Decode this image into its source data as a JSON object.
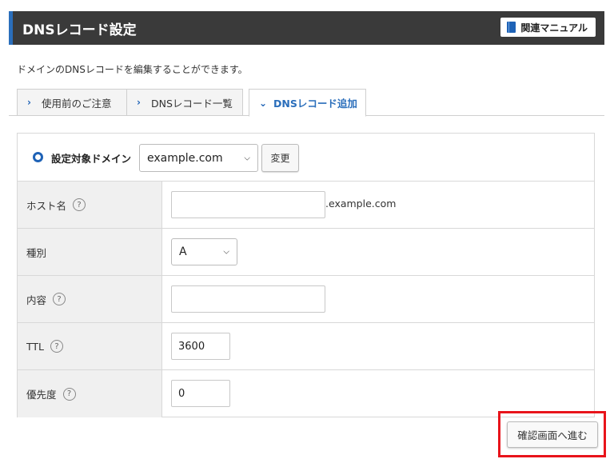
{
  "header": {
    "title": "DNSレコード設定",
    "manual_label": "関連マニュアル"
  },
  "description": "ドメインのDNSレコードを編集することができます。",
  "tabs": [
    {
      "label": "使用前のご注意",
      "active": false
    },
    {
      "label": "DNSレコード一覧",
      "active": false
    },
    {
      "label": "DNSレコード追加",
      "active": true
    }
  ],
  "domain_row": {
    "label": "設定対象ドメイン",
    "selected": "example.com",
    "change_label": "変更"
  },
  "fields": {
    "host": {
      "label": "ホスト名",
      "value": "",
      "suffix": ".example.com"
    },
    "type": {
      "label": "種別",
      "selected": "A"
    },
    "content": {
      "label": "内容",
      "value": ""
    },
    "ttl": {
      "label": "TTL",
      "value": "3600"
    },
    "priority": {
      "label": "優先度",
      "value": "0"
    }
  },
  "help_glyph": "?",
  "submit_label": "確認画面へ進む",
  "colors": {
    "accent": "#1e62b6",
    "header_bg": "#3a3a3a",
    "highlight": "#e8141b"
  }
}
